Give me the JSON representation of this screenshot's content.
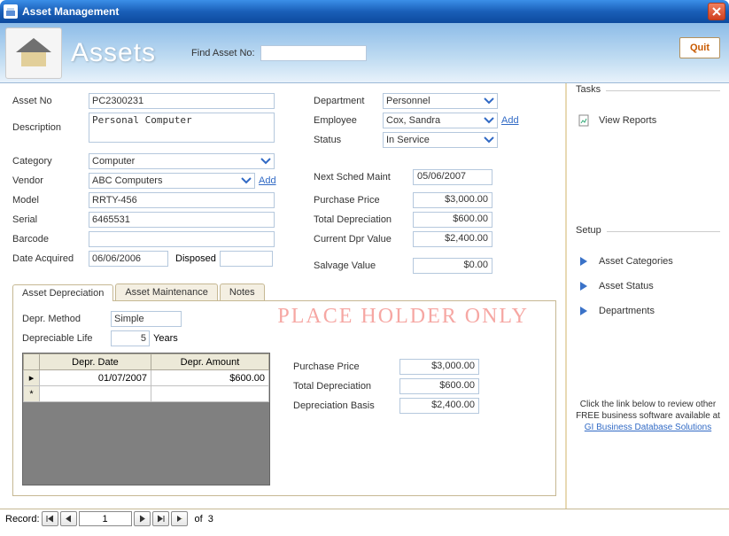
{
  "window": {
    "title": "Asset Management"
  },
  "header": {
    "heading": "Assets",
    "find_label": "Find Asset No:",
    "find_value": "",
    "quit_label": "Quit"
  },
  "form": {
    "asset_no": {
      "label": "Asset No",
      "value": "PC2300231"
    },
    "description": {
      "label": "Description",
      "value": "Personal Computer"
    },
    "category": {
      "label": "Category",
      "value": "Computer"
    },
    "vendor": {
      "label": "Vendor",
      "value": "ABC Computers",
      "add": "Add"
    },
    "model": {
      "label": "Model",
      "value": "RRTY-456"
    },
    "serial": {
      "label": "Serial",
      "value": "6465531"
    },
    "barcode": {
      "label": "Barcode",
      "value": ""
    },
    "date_acquired": {
      "label": "Date Acquired",
      "value": "06/06/2006"
    },
    "disposed": {
      "label": "Disposed",
      "value": ""
    },
    "department": {
      "label": "Department",
      "value": "Personnel"
    },
    "employee": {
      "label": "Employee",
      "value": "Cox, Sandra",
      "add": "Add"
    },
    "status": {
      "label": "Status",
      "value": "In Service"
    },
    "next_sched_maint": {
      "label": "Next Sched Maint",
      "value": "05/06/2007"
    },
    "purchase_price": {
      "label": "Purchase Price",
      "value": "$3,000.00"
    },
    "total_depreciation": {
      "label": "Total Depreciation",
      "value": "$600.00"
    },
    "current_dpr_value": {
      "label": "Current Dpr Value",
      "value": "$2,400.00"
    },
    "salvage_value": {
      "label": "Salvage Value",
      "value": "$0.00"
    }
  },
  "tabs": {
    "depreciation": "Asset Depreciation",
    "maintenance": "Asset Maintenance",
    "notes": "Notes"
  },
  "depr": {
    "method_label": "Depr. Method",
    "method_value": "Simple",
    "life_label": "Depreciable Life",
    "life_value": "5",
    "life_unit": "Years",
    "watermark": "PLACE HOLDER ONLY",
    "grid": {
      "cols": [
        "Depr. Date",
        "Depr. Amount"
      ],
      "rows": [
        {
          "marker": "▸",
          "date": "01/07/2007",
          "amount": "$600.00"
        },
        {
          "marker": "*",
          "date": "",
          "amount": ""
        }
      ]
    },
    "summary": {
      "purchase_price": {
        "label": "Purchase Price",
        "value": "$3,000.00"
      },
      "total_depr": {
        "label": "Total Depreciation",
        "value": "$600.00"
      },
      "basis": {
        "label": "Depreciation Basis",
        "value": "$2,400.00"
      }
    }
  },
  "side": {
    "tasks_title": "Tasks",
    "view_reports": "View Reports",
    "setup_title": "Setup",
    "asset_categories": "Asset Categories",
    "asset_status": "Asset Status",
    "departments": "Departments",
    "note_line1": "Click the link below to review other",
    "note_line2": "FREE business software available at",
    "note_link": "GI Business Database Solutions"
  },
  "recnav": {
    "label": "Record:",
    "current": "1",
    "of": "of",
    "total": "3"
  }
}
